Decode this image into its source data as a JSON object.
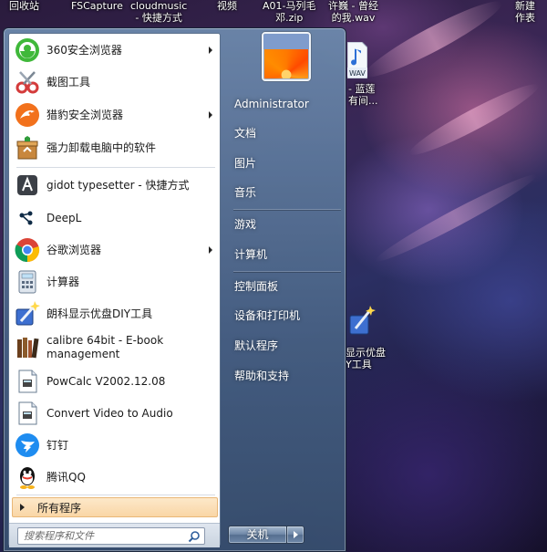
{
  "desktop": {
    "top_labels": [
      "回收站",
      "FSCapture",
      "cloudmusic\n- 快捷方式",
      "视频",
      "A01-马列毛\n邓.zip",
      "许巍 - 曾经\n的我.wav",
      "新建\n作表"
    ],
    "wav_icon_label": "WAV",
    "wav_file_label": "- 蓝莲\n有间...",
    "diy_tool_label": "显示优盘\nY工具"
  },
  "programs": [
    {
      "label": "360安全浏览器",
      "icon": "360-browser-icon",
      "has_submenu": true
    },
    {
      "label": "截图工具",
      "icon": "snipping-tool-icon",
      "has_submenu": false
    },
    {
      "label": "猎豹安全浏览器",
      "icon": "cheetah-browser-icon",
      "has_submenu": true
    },
    {
      "label": "强力卸载电脑中的软件",
      "icon": "uninstaller-icon",
      "has_submenu": false
    },
    {
      "label": "gidot typesetter - 快捷方式",
      "icon": "gidot-typesetter-icon",
      "has_submenu": false
    },
    {
      "label": "DeepL",
      "icon": "deepl-icon",
      "has_submenu": false
    },
    {
      "label": "谷歌浏览器",
      "icon": "chrome-icon",
      "has_submenu": true
    },
    {
      "label": "计算器",
      "icon": "calculator-icon",
      "has_submenu": false
    },
    {
      "label": "朗科显示优盘DIY工具",
      "icon": "netac-diy-tool-icon",
      "has_submenu": false
    },
    {
      "label": "calibre 64bit - E-book management",
      "icon": "calibre-icon",
      "has_submenu": false
    },
    {
      "label": "PowCalc V2002.12.08",
      "icon": "powcalc-icon",
      "has_submenu": false
    },
    {
      "label": "Convert Video to Audio",
      "icon": "convert-video-icon",
      "has_submenu": false
    },
    {
      "label": "钉钉",
      "icon": "dingtalk-icon",
      "has_submenu": false
    },
    {
      "label": "腾讯QQ",
      "icon": "qq-icon",
      "has_submenu": false
    }
  ],
  "all_programs_label": "所有程序",
  "search": {
    "placeholder": "搜索程序和文件"
  },
  "right_pane": {
    "user_name": "Administrator",
    "items": [
      "文档",
      "图片",
      "音乐",
      "游戏",
      "计算机",
      "控制面板",
      "设备和打印机",
      "默认程序",
      "帮助和支持"
    ]
  },
  "shutdown_label": "关机",
  "colors": {
    "all_programs_highlight": "#f9d6a6",
    "menu_frame": "#5b708c"
  }
}
